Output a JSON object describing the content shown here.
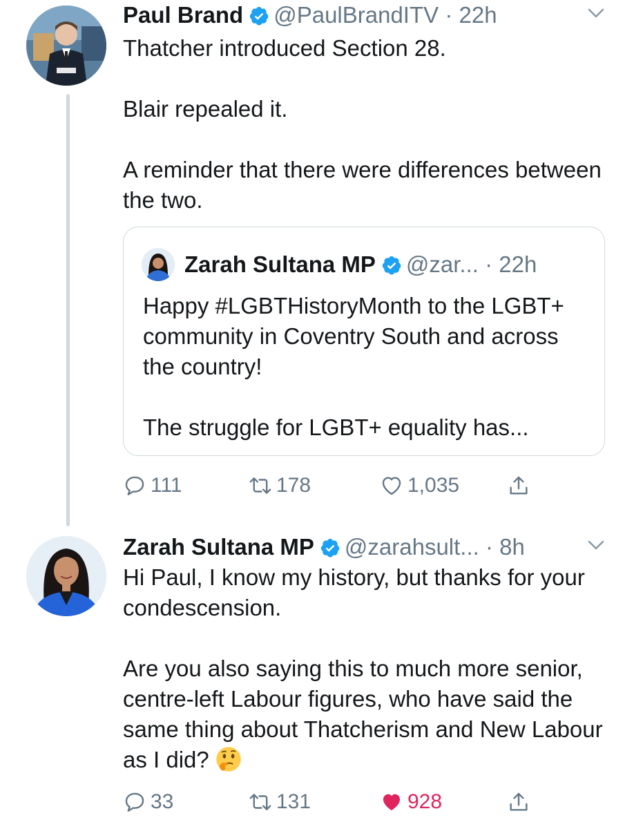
{
  "tweet1": {
    "name": "Paul Brand",
    "handle": "@PaulBrandITV",
    "time": "22h",
    "paragraphs": [
      "Thatcher introduced Section 28.",
      "Blair repealed it.",
      "A reminder that there were differences between the two."
    ],
    "quoted": {
      "name": "Zarah Sultana MP",
      "handle": "@zar...",
      "time": "22h",
      "paragraphs": [
        "Happy #LGBTHistoryMonth to the LGBT+ community in Coventry South and across the country!",
        "The struggle for LGBT+ equality has..."
      ]
    },
    "actions": {
      "replies": "111",
      "retweets": "178",
      "likes": "1,035"
    }
  },
  "tweet2": {
    "name": "Zarah Sultana MP",
    "handle": "@zarahsult...",
    "time": "8h",
    "paragraphs": [
      "Hi Paul, I know my history, but thanks for your condescension.",
      "Are you also saying this to much more senior, centre-left Labour figures, who have said the same thing about Thatcherism and New Labour as I did?"
    ],
    "emoji": "thinking-face",
    "actions": {
      "replies": "33",
      "retweets": "131",
      "likes": "928",
      "liked": true
    }
  },
  "colors": {
    "verified": "#1da1f2",
    "muted": "#657786",
    "like": "#e0245e",
    "border": "#cfd9de"
  }
}
